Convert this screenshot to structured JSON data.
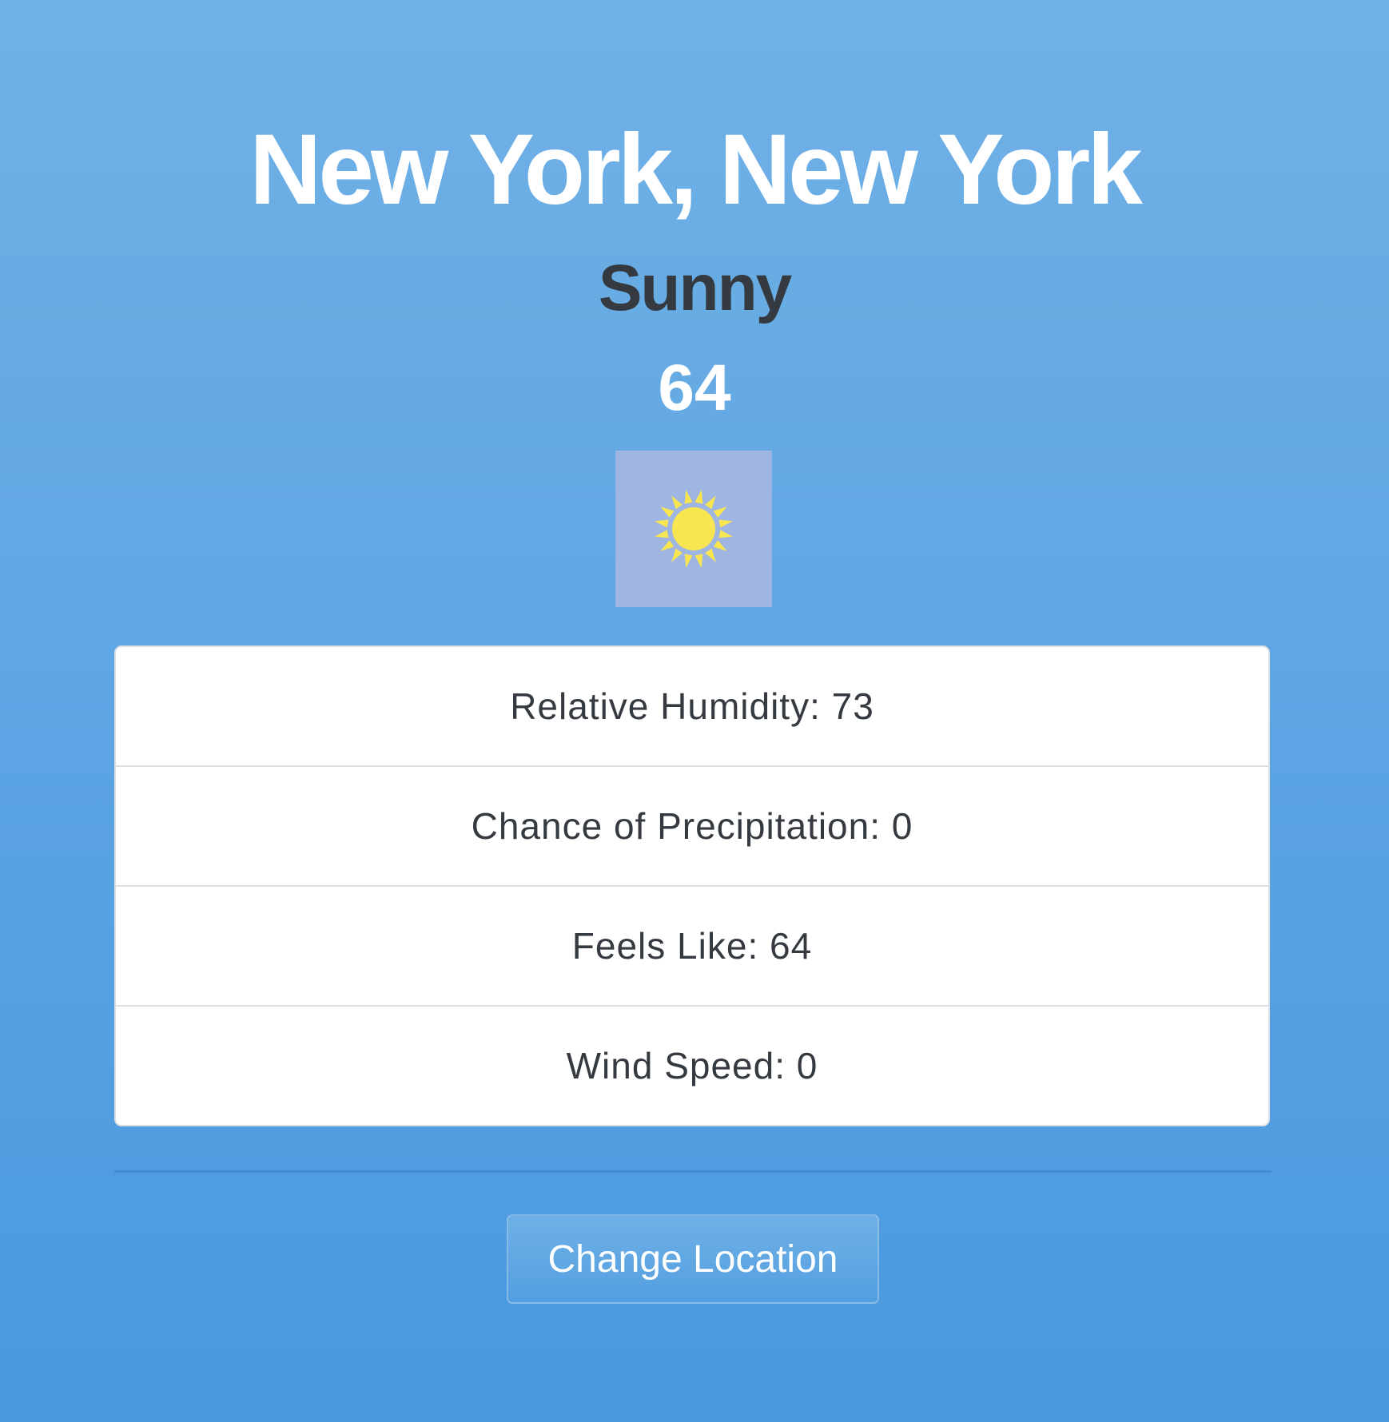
{
  "location": "New York, New York",
  "condition": "Sunny",
  "temperature": "64",
  "icon": "sun-icon",
  "icon_color": "#f8e54f",
  "details": [
    {
      "label": "Relative Humidity: 73"
    },
    {
      "label": "Chance of Precipitation: 0"
    },
    {
      "label": "Feels Like: 64"
    },
    {
      "label": "Wind Speed: 0"
    }
  ],
  "actions": {
    "change_location_label": "Change Location"
  }
}
